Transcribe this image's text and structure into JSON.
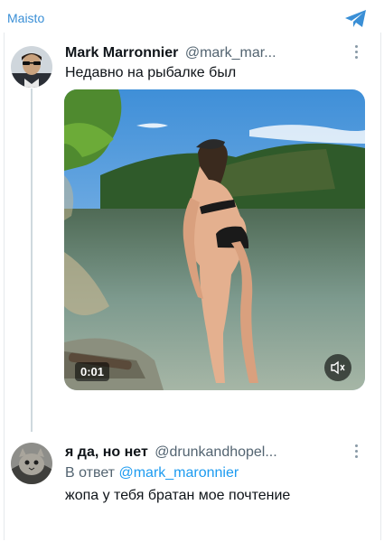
{
  "channel": {
    "name": "Maisto",
    "icon": "telegram-icon",
    "accent": "#3a8fd6"
  },
  "tweet": {
    "display_name": "Mark Marronnier",
    "handle": "@mark_mar...",
    "text": "Недавно на рыбалке был",
    "media": {
      "type": "video",
      "timestamp": "0:01",
      "mute_icon": "speaker-muted-icon"
    }
  },
  "reply": {
    "display_name": "я да, но нет",
    "handle": "@drunkandhopel...",
    "in_reply_prefix": "В ответ",
    "in_reply_handle": "@mark_maronnier",
    "text": "жопа у тебя братан мое почтение"
  },
  "colors": {
    "link": "#1d9bf0",
    "secondary_text": "#536471",
    "thread_line": "#cfd9de"
  }
}
